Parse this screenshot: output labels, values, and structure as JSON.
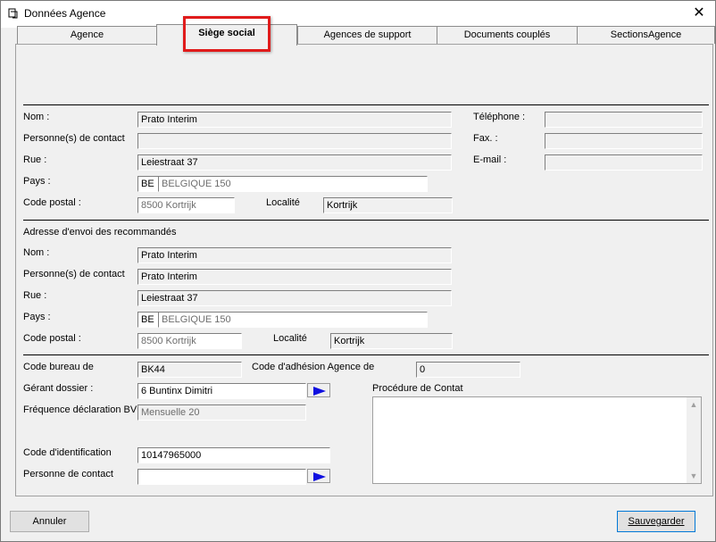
{
  "window": {
    "title": "Données Agence",
    "close": "✕"
  },
  "tabs": [
    "Agence",
    "Siège social",
    "Agences de support",
    "Documents couplés",
    "SectionsAgence"
  ],
  "headquarters": {
    "name_label": "Nom :",
    "name": "Prato Interim",
    "contact_label": "Personne(s) de contact",
    "contact": "",
    "street_label": "Rue :",
    "street": "Leiestraat 37",
    "country_label": "Pays :",
    "country_code": "BE",
    "country_name": "BELGIQUE 150",
    "postal_label": "Code postal :",
    "postal": "8500 Kortrijk",
    "city_label": "Localité",
    "city": "Kortrijk",
    "phone_label": "Téléphone :",
    "phone": "",
    "fax_label": "Fax. :",
    "fax": "",
    "email_label": "E-mail :",
    "email": ""
  },
  "registered_mail": {
    "section_title": "Adresse d'envoi des recommandés",
    "name_label": "Nom :",
    "name": "Prato Interim",
    "contact_label": "Personne(s) de contact",
    "contact": "Prato Interim",
    "street_label": "Rue :",
    "street": "Leiestraat 37",
    "country_label": "Pays :",
    "country_code": "BE",
    "country_name": "BELGIQUE 150",
    "postal_label": "Code postal :",
    "postal": "8500 Kortrijk",
    "city_label": "Localité",
    "city": "Kortrijk"
  },
  "office": {
    "bureau_label": "Code bureau de",
    "bureau": "BK44",
    "adhesion_label": "Code d'adhésion Agence de",
    "adhesion": "0",
    "manager_label": "Gérant dossier :",
    "manager": "6 Buntinx Dimitri",
    "frequency_label": "Fréquence déclaration BV",
    "frequency": "Mensuelle 20",
    "ident_label": "Code d'identification",
    "ident": "10147965000",
    "contact_label": "Personne de contact",
    "contact": "",
    "procedure_label": "Procédure de Contat"
  },
  "buttons": {
    "cancel": "Annuler",
    "save": "Sauvegarder"
  },
  "colors": {
    "highlight": "#e01b1b",
    "arrow": "#1010e0"
  }
}
